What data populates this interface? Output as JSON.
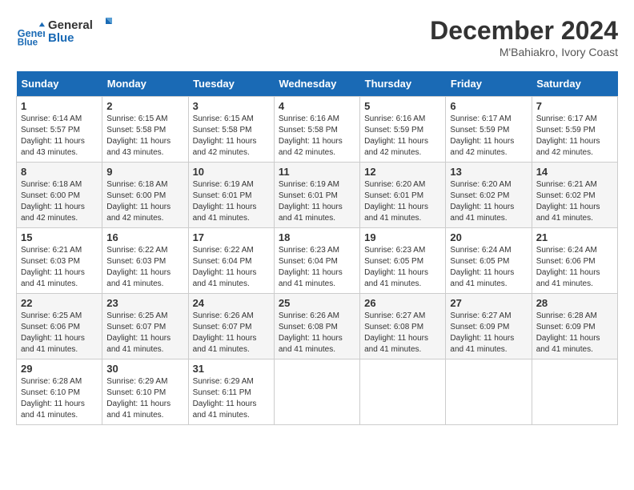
{
  "header": {
    "logo_line1": "General",
    "logo_line2": "Blue",
    "month": "December 2024",
    "location": "M'Bahiakro, Ivory Coast"
  },
  "weekdays": [
    "Sunday",
    "Monday",
    "Tuesday",
    "Wednesday",
    "Thursday",
    "Friday",
    "Saturday"
  ],
  "weeks": [
    [
      {
        "day": "1",
        "info": "Sunrise: 6:14 AM\nSunset: 5:57 PM\nDaylight: 11 hours\nand 43 minutes."
      },
      {
        "day": "2",
        "info": "Sunrise: 6:15 AM\nSunset: 5:58 PM\nDaylight: 11 hours\nand 43 minutes."
      },
      {
        "day": "3",
        "info": "Sunrise: 6:15 AM\nSunset: 5:58 PM\nDaylight: 11 hours\nand 42 minutes."
      },
      {
        "day": "4",
        "info": "Sunrise: 6:16 AM\nSunset: 5:58 PM\nDaylight: 11 hours\nand 42 minutes."
      },
      {
        "day": "5",
        "info": "Sunrise: 6:16 AM\nSunset: 5:59 PM\nDaylight: 11 hours\nand 42 minutes."
      },
      {
        "day": "6",
        "info": "Sunrise: 6:17 AM\nSunset: 5:59 PM\nDaylight: 11 hours\nand 42 minutes."
      },
      {
        "day": "7",
        "info": "Sunrise: 6:17 AM\nSunset: 5:59 PM\nDaylight: 11 hours\nand 42 minutes."
      }
    ],
    [
      {
        "day": "8",
        "info": "Sunrise: 6:18 AM\nSunset: 6:00 PM\nDaylight: 11 hours\nand 42 minutes."
      },
      {
        "day": "9",
        "info": "Sunrise: 6:18 AM\nSunset: 6:00 PM\nDaylight: 11 hours\nand 42 minutes."
      },
      {
        "day": "10",
        "info": "Sunrise: 6:19 AM\nSunset: 6:01 PM\nDaylight: 11 hours\nand 41 minutes."
      },
      {
        "day": "11",
        "info": "Sunrise: 6:19 AM\nSunset: 6:01 PM\nDaylight: 11 hours\nand 41 minutes."
      },
      {
        "day": "12",
        "info": "Sunrise: 6:20 AM\nSunset: 6:01 PM\nDaylight: 11 hours\nand 41 minutes."
      },
      {
        "day": "13",
        "info": "Sunrise: 6:20 AM\nSunset: 6:02 PM\nDaylight: 11 hours\nand 41 minutes."
      },
      {
        "day": "14",
        "info": "Sunrise: 6:21 AM\nSunset: 6:02 PM\nDaylight: 11 hours\nand 41 minutes."
      }
    ],
    [
      {
        "day": "15",
        "info": "Sunrise: 6:21 AM\nSunset: 6:03 PM\nDaylight: 11 hours\nand 41 minutes."
      },
      {
        "day": "16",
        "info": "Sunrise: 6:22 AM\nSunset: 6:03 PM\nDaylight: 11 hours\nand 41 minutes."
      },
      {
        "day": "17",
        "info": "Sunrise: 6:22 AM\nSunset: 6:04 PM\nDaylight: 11 hours\nand 41 minutes."
      },
      {
        "day": "18",
        "info": "Sunrise: 6:23 AM\nSunset: 6:04 PM\nDaylight: 11 hours\nand 41 minutes."
      },
      {
        "day": "19",
        "info": "Sunrise: 6:23 AM\nSunset: 6:05 PM\nDaylight: 11 hours\nand 41 minutes."
      },
      {
        "day": "20",
        "info": "Sunrise: 6:24 AM\nSunset: 6:05 PM\nDaylight: 11 hours\nand 41 minutes."
      },
      {
        "day": "21",
        "info": "Sunrise: 6:24 AM\nSunset: 6:06 PM\nDaylight: 11 hours\nand 41 minutes."
      }
    ],
    [
      {
        "day": "22",
        "info": "Sunrise: 6:25 AM\nSunset: 6:06 PM\nDaylight: 11 hours\nand 41 minutes."
      },
      {
        "day": "23",
        "info": "Sunrise: 6:25 AM\nSunset: 6:07 PM\nDaylight: 11 hours\nand 41 minutes."
      },
      {
        "day": "24",
        "info": "Sunrise: 6:26 AM\nSunset: 6:07 PM\nDaylight: 11 hours\nand 41 minutes."
      },
      {
        "day": "25",
        "info": "Sunrise: 6:26 AM\nSunset: 6:08 PM\nDaylight: 11 hours\nand 41 minutes."
      },
      {
        "day": "26",
        "info": "Sunrise: 6:27 AM\nSunset: 6:08 PM\nDaylight: 11 hours\nand 41 minutes."
      },
      {
        "day": "27",
        "info": "Sunrise: 6:27 AM\nSunset: 6:09 PM\nDaylight: 11 hours\nand 41 minutes."
      },
      {
        "day": "28",
        "info": "Sunrise: 6:28 AM\nSunset: 6:09 PM\nDaylight: 11 hours\nand 41 minutes."
      }
    ],
    [
      {
        "day": "29",
        "info": "Sunrise: 6:28 AM\nSunset: 6:10 PM\nDaylight: 11 hours\nand 41 minutes."
      },
      {
        "day": "30",
        "info": "Sunrise: 6:29 AM\nSunset: 6:10 PM\nDaylight: 11 hours\nand 41 minutes."
      },
      {
        "day": "31",
        "info": "Sunrise: 6:29 AM\nSunset: 6:11 PM\nDaylight: 11 hours\nand 41 minutes."
      },
      {
        "day": "",
        "info": ""
      },
      {
        "day": "",
        "info": ""
      },
      {
        "day": "",
        "info": ""
      },
      {
        "day": "",
        "info": ""
      }
    ]
  ]
}
